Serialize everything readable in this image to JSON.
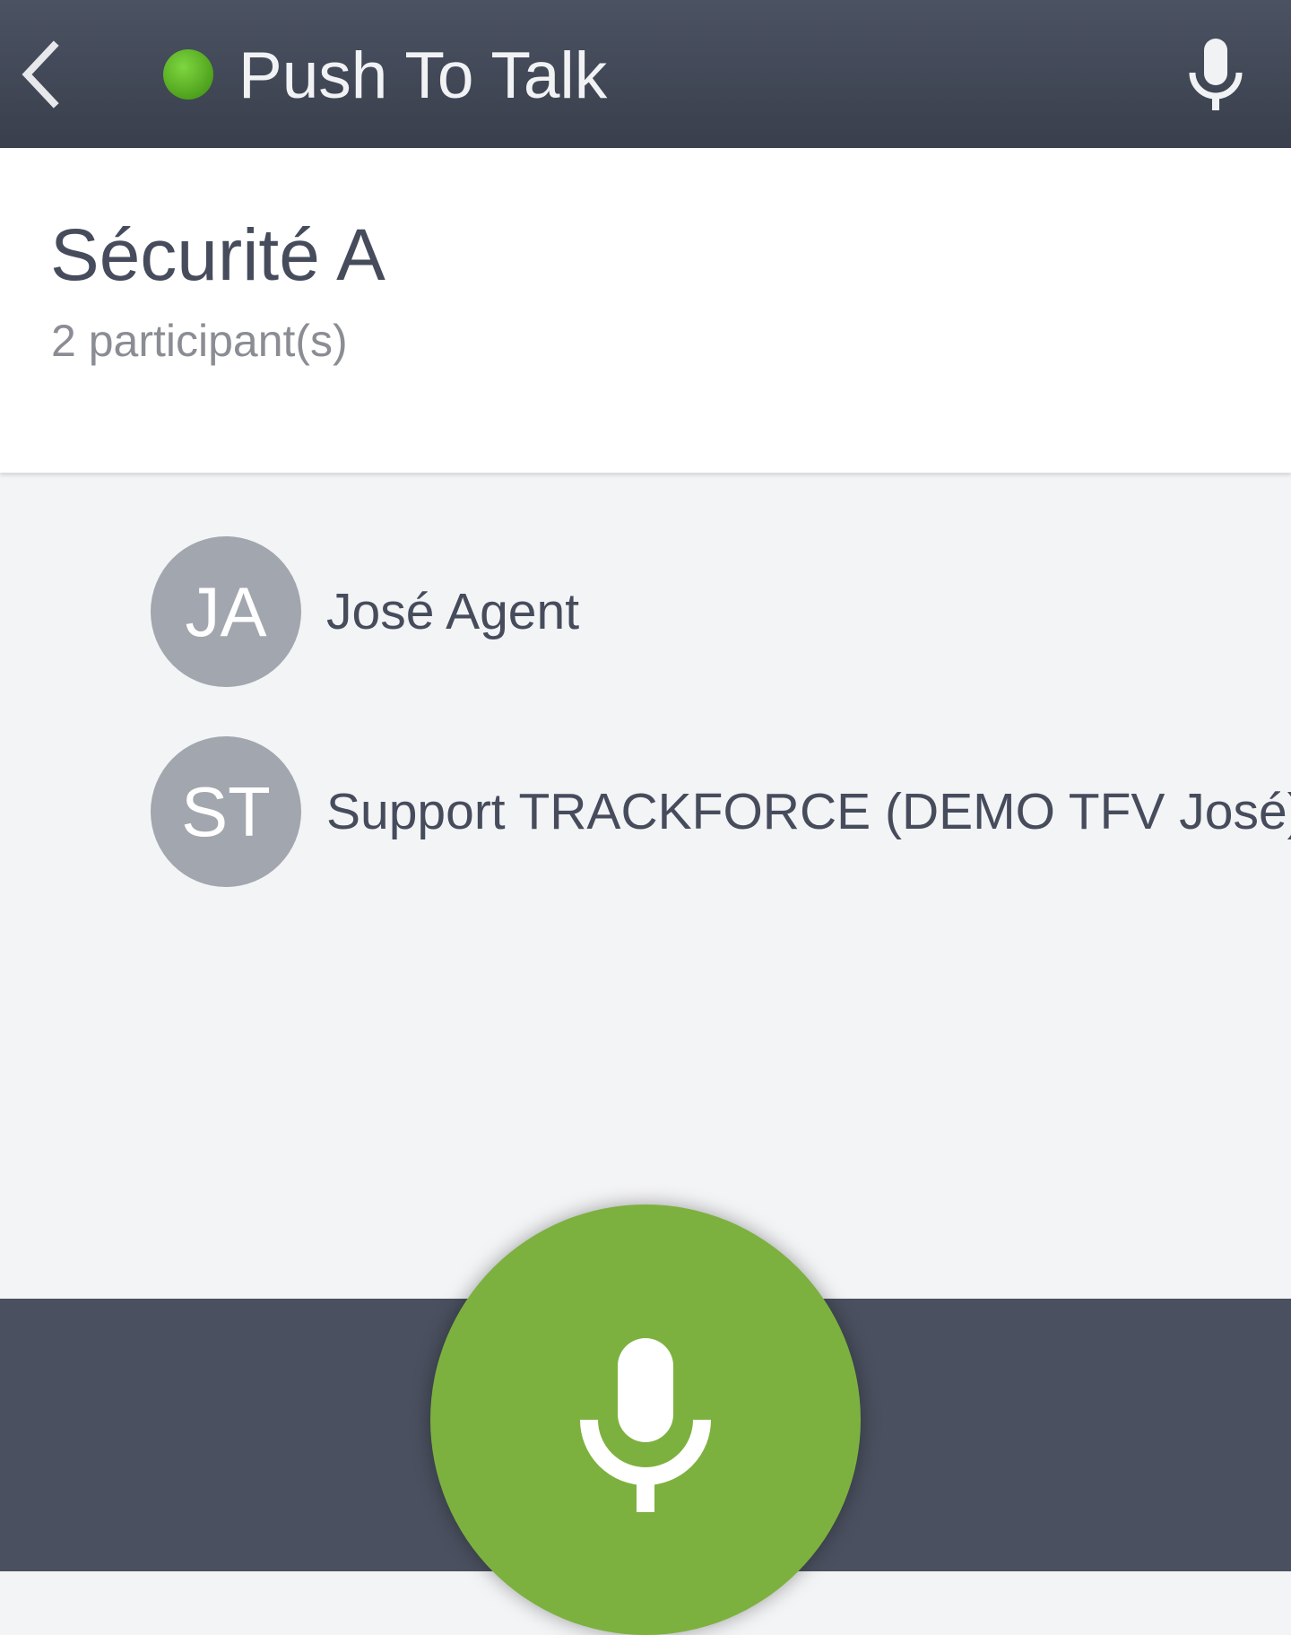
{
  "header": {
    "title": "Push To Talk",
    "status": "online",
    "status_color": "#5cb82c",
    "back_icon": "chevron-left-icon",
    "mic_icon": "microphone-icon"
  },
  "group": {
    "name": "Sécurité A",
    "participant_count": "2 participant(s)"
  },
  "participants": [
    {
      "initials": "JA",
      "name": "José Agent"
    },
    {
      "initials": "ST",
      "name": "Support TRACKFORCE (DEMO TFV José)"
    }
  ],
  "ptt": {
    "icon": "microphone-icon",
    "color": "#7db13f"
  },
  "colors": {
    "header_bg": "#434957",
    "bottom_bar_bg": "#4a505f",
    "avatar_bg": "#a2a6ae",
    "text_primary": "#464c5c"
  }
}
